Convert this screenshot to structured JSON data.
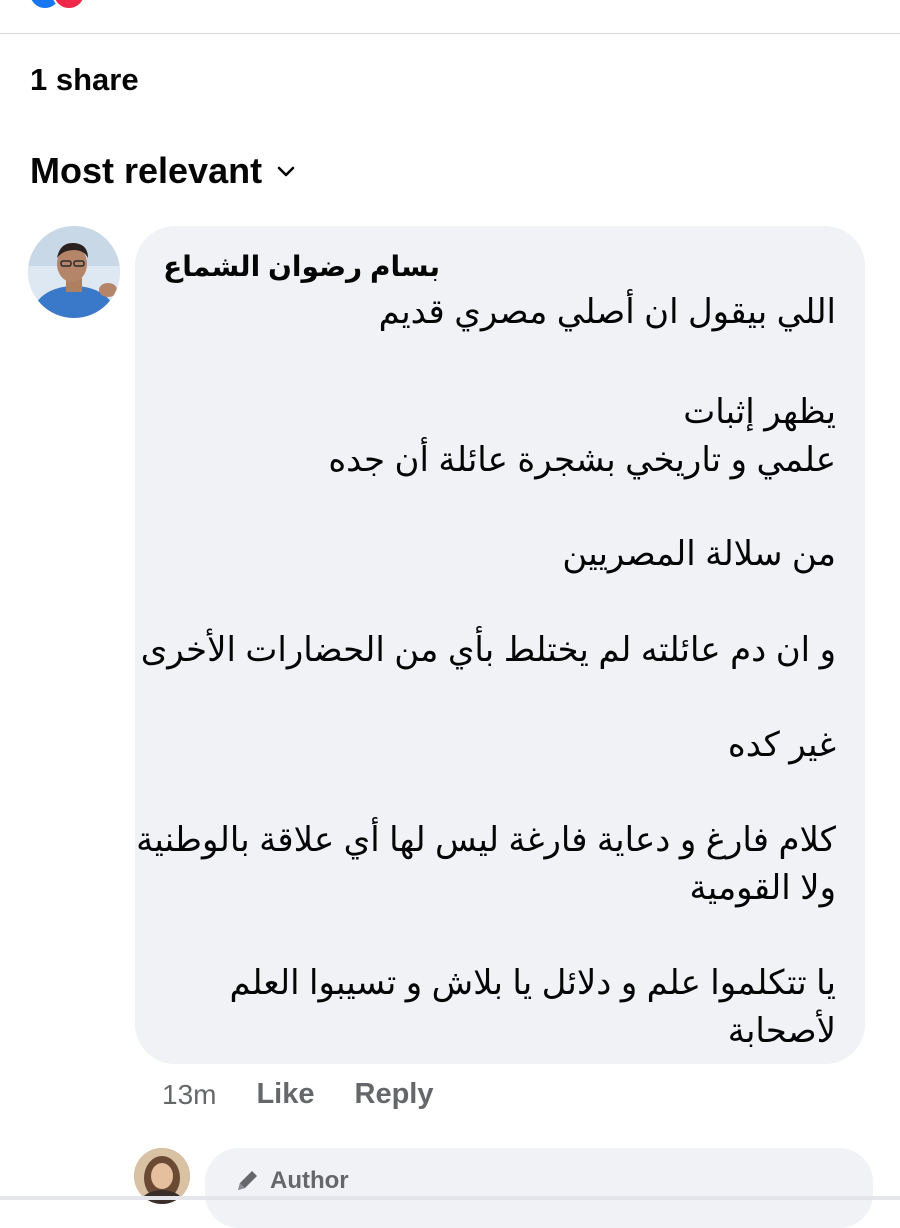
{
  "post": {
    "share_count": "1 share"
  },
  "comments_header": {
    "sort_label": "Most relevant"
  },
  "comment": {
    "author": "بسام رضوان الشماع",
    "lines": [
      "اللي بيقول ان أصلي مصري قديم",
      "يظهر إثبات",
      "علمي و تاريخي  بشجرة عائلة  أن جده",
      "من سلالة المصريين",
      "و ان دم عائلته لم يختلط  بأي من الحضارات الأخرى",
      "غير كده",
      "كلام فارغ و دعاية فارغة ليس لها أي علاقة بالوطنية",
      "ولا القومية",
      "يا تتكلموا علم و دلائل يا بلاش و تسيبوا العلم",
      "لأصحابة"
    ],
    "time": "13m",
    "like_label": "Like",
    "reply_label": "Reply"
  },
  "reply": {
    "badge_label": "Author"
  },
  "colors": {
    "bubble": "#f0f2f5",
    "meta_gray": "#65676b",
    "text": "#050505",
    "like_blue": "#1877f2",
    "love_red": "#f02849"
  },
  "icons": [
    "like-reaction-icon",
    "love-reaction-icon",
    "chevron-down-icon",
    "pencil-icon"
  ]
}
